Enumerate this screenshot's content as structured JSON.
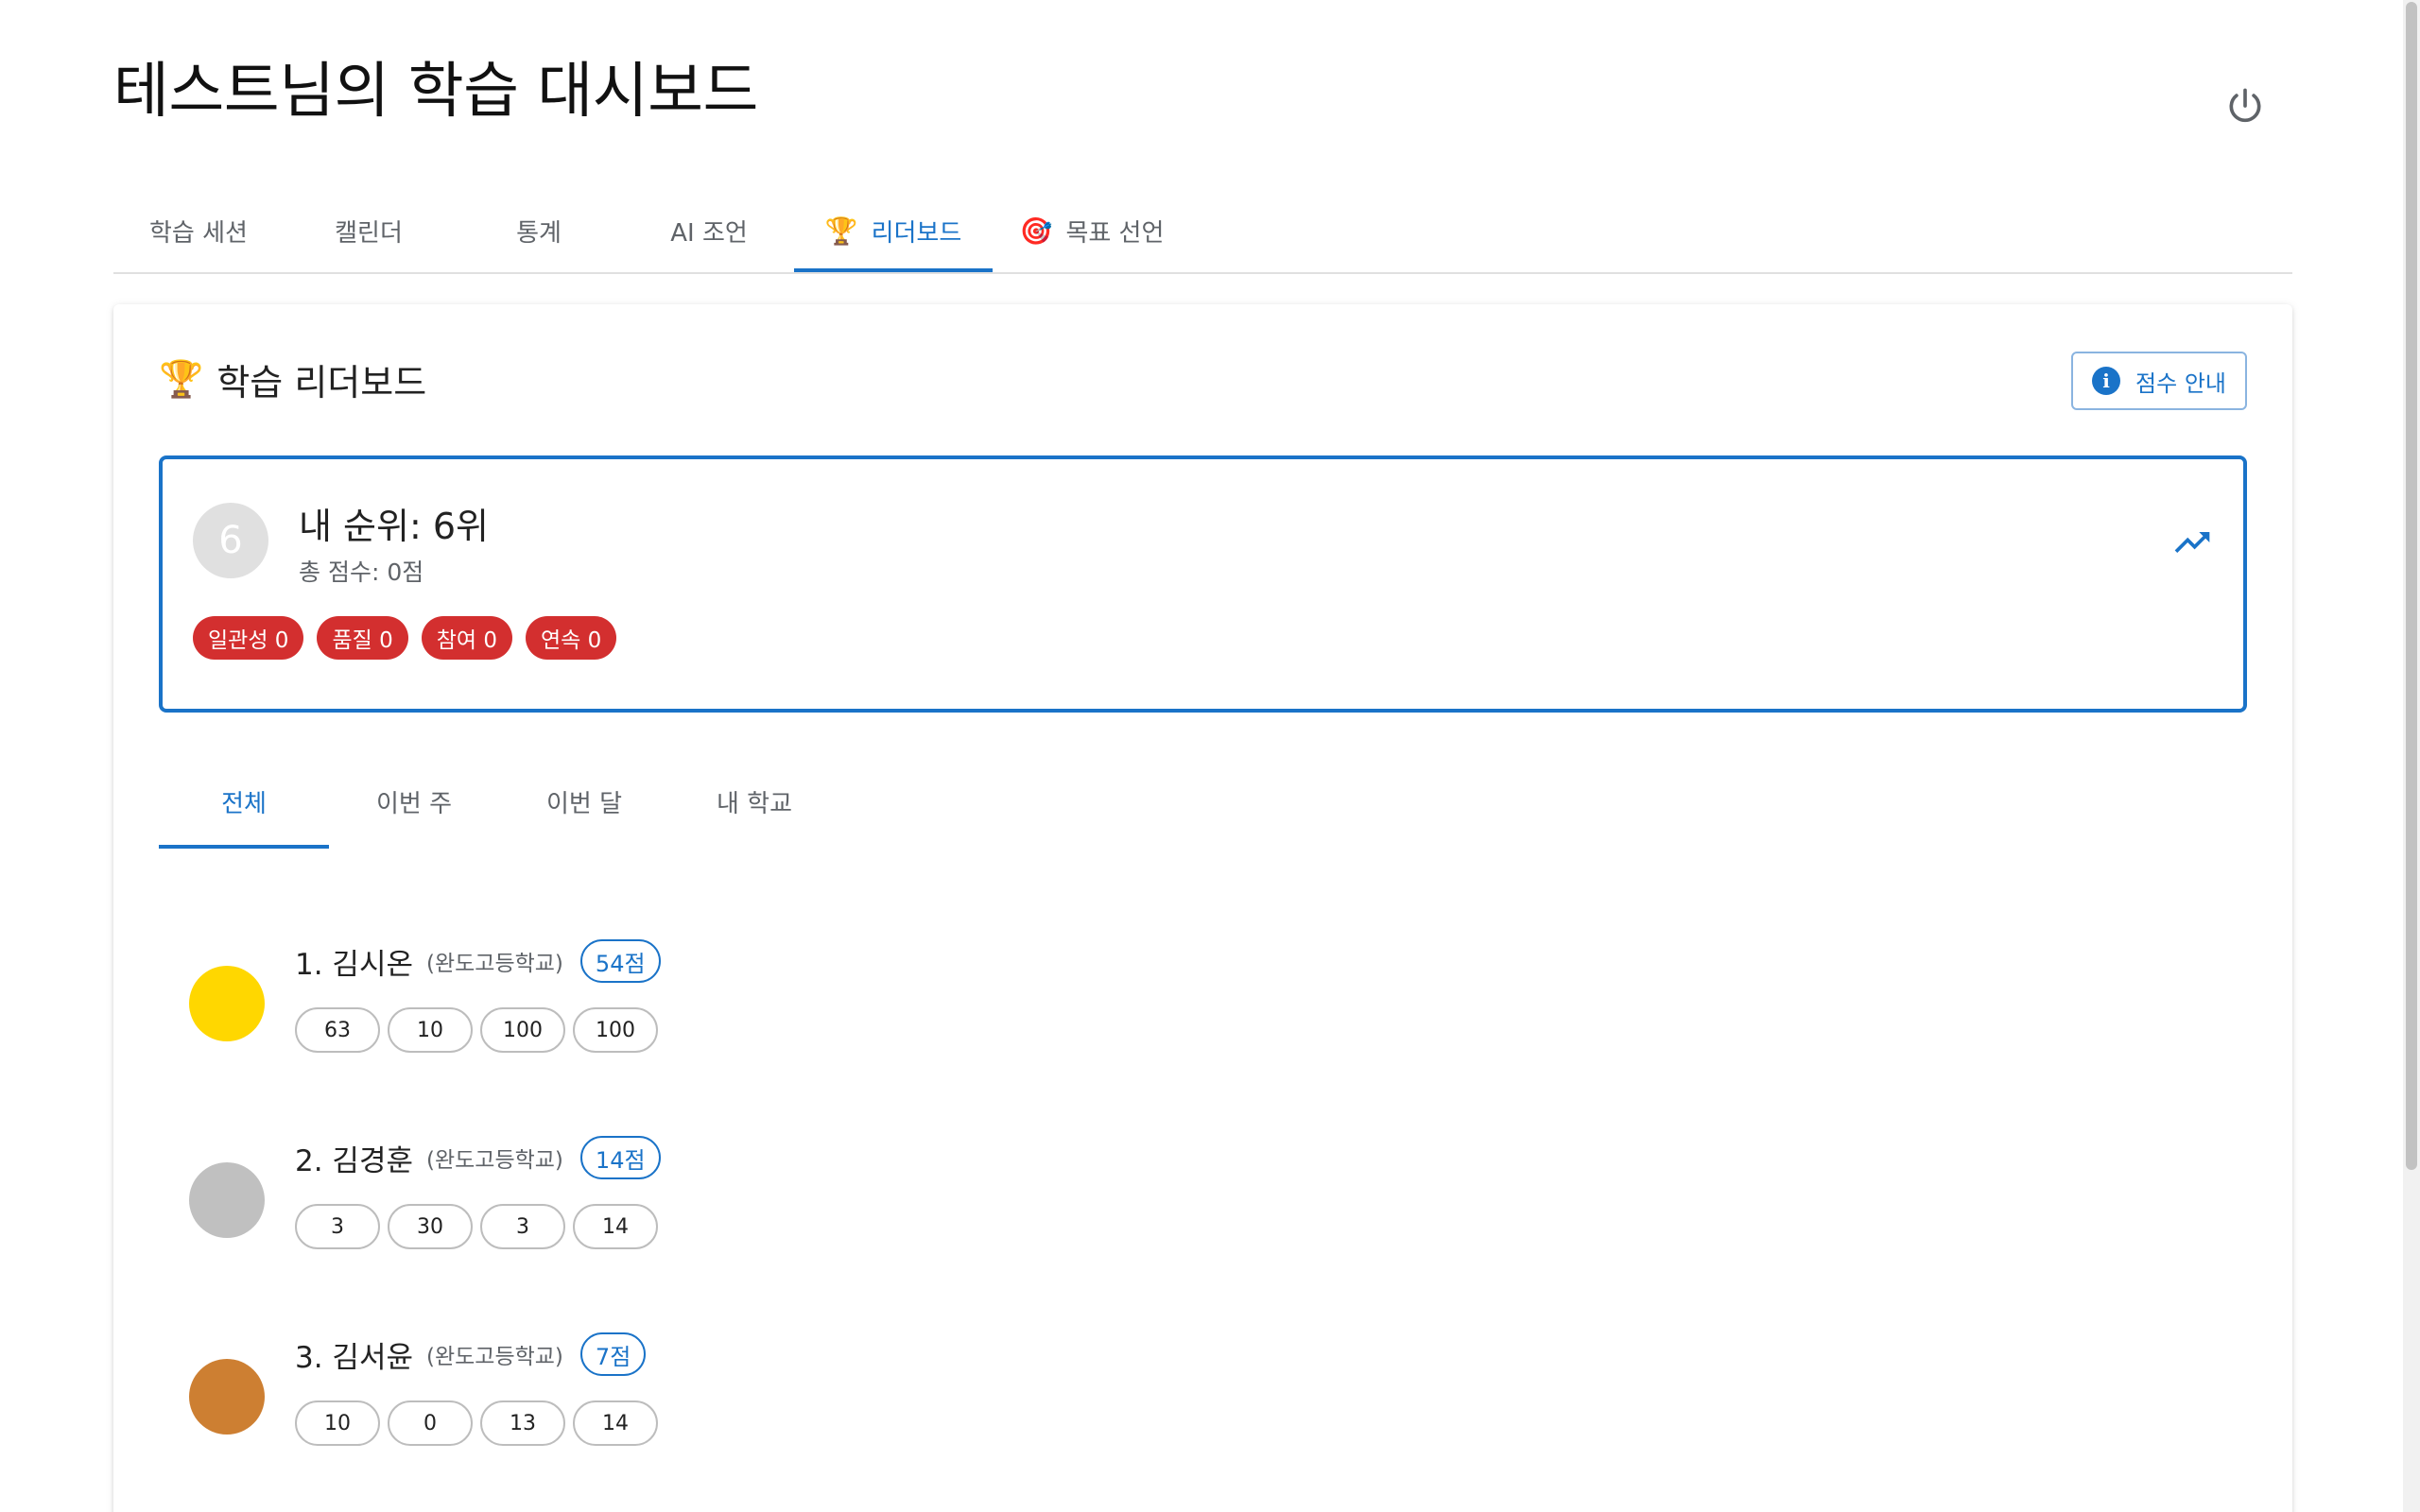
{
  "header": {
    "title": "테스트님의 학습 대시보드",
    "power_icon": "power-icon"
  },
  "main_tabs": [
    {
      "label": "학습 세션",
      "icon": ""
    },
    {
      "label": "캘린더",
      "icon": ""
    },
    {
      "label": "통계",
      "icon": ""
    },
    {
      "label": "AI 조언",
      "icon": ""
    },
    {
      "label": "리더보드",
      "icon": "🏆",
      "active": true
    },
    {
      "label": "목표 선언",
      "icon": "🎯"
    }
  ],
  "card": {
    "title": "학습 리더보드",
    "title_icon": "🏆",
    "score_guide_label": "점수 안내",
    "my_rank": {
      "avatar_text": "6",
      "title": "내 순위: 6위",
      "total": "총 점수: 0점",
      "chips": [
        "일관성 0",
        "품질 0",
        "참여 0",
        "연속 0"
      ]
    },
    "sub_tabs": [
      {
        "label": "전체",
        "active": true
      },
      {
        "label": "이번 주"
      },
      {
        "label": "이번 달"
      },
      {
        "label": "내 학교"
      }
    ],
    "leaderboard": [
      {
        "name": "1. 김시온",
        "school": "(완도고등학교)",
        "score": "54점",
        "medal_color": "#FFD700",
        "stats": [
          "63",
          "10",
          "100",
          "100"
        ]
      },
      {
        "name": "2. 김경훈",
        "school": "(완도고등학교)",
        "score": "14점",
        "medal_color": "#C0C0C0",
        "stats": [
          "3",
          "30",
          "3",
          "14"
        ]
      },
      {
        "name": "3. 김서윤",
        "school": "(완도고등학교)",
        "score": "7점",
        "medal_color": "#CD7F32",
        "stats": [
          "10",
          "0",
          "13",
          "14"
        ]
      }
    ]
  },
  "colors": {
    "primary": "#1a73c8",
    "danger": "#d32f2f"
  }
}
